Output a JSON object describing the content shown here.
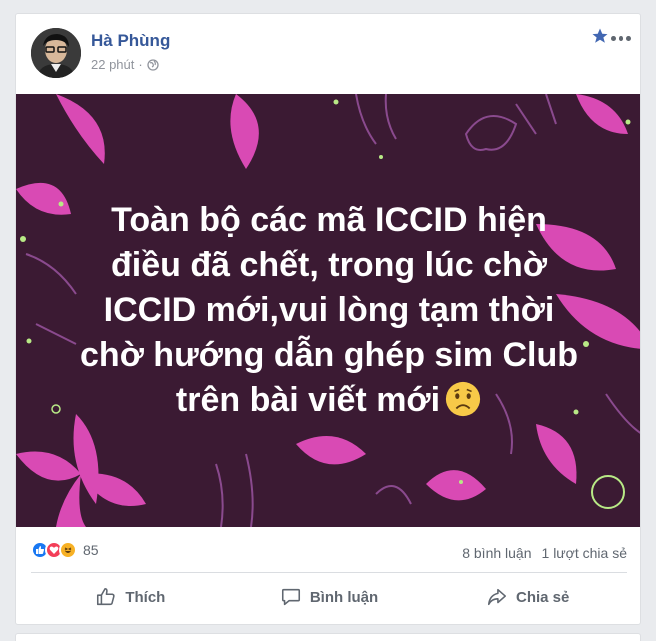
{
  "post": {
    "author": "Hà Phùng",
    "time": "22 phút",
    "separator": "·",
    "text_lines": [
      "Toàn bộ các mã ICCID hiện",
      "điều đã chết, trong lúc chờ",
      "ICCID mới,vui lòng tạm thời",
      "chờ hướng dẫn ghép sim Club",
      "trên bài viết mới"
    ],
    "emoji": "sad-face-emoji",
    "background_color": "#3b1a33",
    "accent_color": "#d94ab4"
  },
  "stats": {
    "reaction_count": "85",
    "comments": "8 bình luận",
    "shares": "1 lượt chia sẻ"
  },
  "actions": {
    "like": "Thích",
    "comment": "Bình luận",
    "share": "Chia sẻ"
  },
  "colors": {
    "author_link": "#365899",
    "like_blue": "#1877f2",
    "love_red": "#f33e58",
    "haha_yellow": "#f7b125"
  }
}
